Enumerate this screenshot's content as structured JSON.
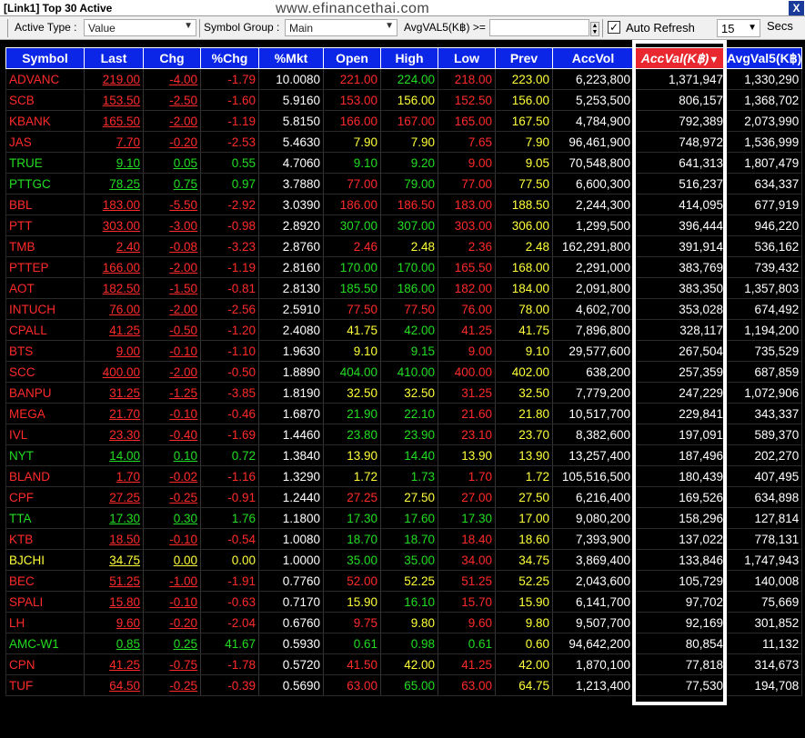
{
  "window": {
    "title": "[Link1] Top 30 Active",
    "watermark": "www.efinancethai.com",
    "close_label": "X"
  },
  "toolbar": {
    "active_type_label": "Active Type :",
    "active_type_value": "Value",
    "symbol_group_label": "Symbol Group :",
    "symbol_group_value": "Main",
    "avgval_label": "AvgVAL5(K฿) >=",
    "auto_refresh_label": "Auto Refresh",
    "auto_refresh_checked": "✓",
    "refresh_interval": "15",
    "secs_label": "Secs"
  },
  "table": {
    "headers": [
      "Symbol",
      "Last",
      "Chg",
      "%Chg",
      "%Mkt",
      "Open",
      "High",
      "Low",
      "Prev",
      "AccVol",
      "AccVal(K฿)",
      "AvgVal5(K฿)"
    ],
    "rows": [
      {
        "c": "red",
        "symbol": "ADVANC",
        "last": "219.00",
        "chg": "-4.00",
        "pchg": "-1.79",
        "mkt": "10.0080",
        "open": "221.00",
        "open_c": "red",
        "high": "224.00",
        "high_c": "green",
        "low": "218.00",
        "low_c": "red",
        "prev": "223.00",
        "accvol": "6,223,800",
        "accval": "1,371,947",
        "avgval": "1,330,290"
      },
      {
        "c": "red",
        "symbol": "SCB",
        "last": "153.50",
        "chg": "-2.50",
        "pchg": "-1.60",
        "mkt": "5.9160",
        "open": "153.00",
        "open_c": "red",
        "high": "156.00",
        "high_c": "yellow",
        "low": "152.50",
        "low_c": "red",
        "prev": "156.00",
        "accvol": "5,253,500",
        "accval": "806,157",
        "avgval": "1,368,702"
      },
      {
        "c": "red",
        "symbol": "KBANK",
        "last": "165.50",
        "chg": "-2.00",
        "pchg": "-1.19",
        "mkt": "5.8150",
        "open": "166.00",
        "open_c": "red",
        "high": "167.00",
        "high_c": "red",
        "low": "165.00",
        "low_c": "red",
        "prev": "167.50",
        "accvol": "4,784,900",
        "accval": "792,389",
        "avgval": "2,073,990"
      },
      {
        "c": "red",
        "symbol": "JAS",
        "last": "7.70",
        "chg": "-0.20",
        "pchg": "-2.53",
        "mkt": "5.4630",
        "open": "7.90",
        "open_c": "yellow",
        "high": "7.90",
        "high_c": "yellow",
        "low": "7.65",
        "low_c": "red",
        "prev": "7.90",
        "accvol": "96,461,900",
        "accval": "748,972",
        "avgval": "1,536,999"
      },
      {
        "c": "green",
        "symbol": "TRUE",
        "last": "9.10",
        "chg": "0.05",
        "pchg": "0.55",
        "mkt": "4.7060",
        "open": "9.10",
        "open_c": "green",
        "high": "9.20",
        "high_c": "green",
        "low": "9.00",
        "low_c": "red",
        "prev": "9.05",
        "accvol": "70,548,800",
        "accval": "641,313",
        "avgval": "1,807,479"
      },
      {
        "c": "green",
        "symbol": "PTTGC",
        "last": "78.25",
        "chg": "0.75",
        "pchg": "0.97",
        "mkt": "3.7880",
        "open": "77.00",
        "open_c": "red",
        "high": "79.00",
        "high_c": "green",
        "low": "77.00",
        "low_c": "red",
        "prev": "77.50",
        "accvol": "6,600,300",
        "accval": "516,237",
        "avgval": "634,337"
      },
      {
        "c": "red",
        "symbol": "BBL",
        "last": "183.00",
        "chg": "-5.50",
        "pchg": "-2.92",
        "mkt": "3.0390",
        "open": "186.00",
        "open_c": "red",
        "high": "186.50",
        "high_c": "red",
        "low": "183.00",
        "low_c": "red",
        "prev": "188.50",
        "accvol": "2,244,300",
        "accval": "414,095",
        "avgval": "677,919"
      },
      {
        "c": "red",
        "symbol": "PTT",
        "last": "303.00",
        "chg": "-3.00",
        "pchg": "-0.98",
        "mkt": "2.8920",
        "open": "307.00",
        "open_c": "green",
        "high": "307.00",
        "high_c": "green",
        "low": "303.00",
        "low_c": "red",
        "prev": "306.00",
        "accvol": "1,299,500",
        "accval": "396,444",
        "avgval": "946,220"
      },
      {
        "c": "red",
        "symbol": "TMB",
        "last": "2.40",
        "chg": "-0.08",
        "pchg": "-3.23",
        "mkt": "2.8760",
        "open": "2.46",
        "open_c": "red",
        "high": "2.48",
        "high_c": "yellow",
        "low": "2.36",
        "low_c": "red",
        "prev": "2.48",
        "accvol": "162,291,800",
        "accval": "391,914",
        "avgval": "536,162"
      },
      {
        "c": "red",
        "symbol": "PTTEP",
        "last": "166.00",
        "chg": "-2.00",
        "pchg": "-1.19",
        "mkt": "2.8160",
        "open": "170.00",
        "open_c": "green",
        "high": "170.00",
        "high_c": "green",
        "low": "165.50",
        "low_c": "red",
        "prev": "168.00",
        "accvol": "2,291,000",
        "accval": "383,769",
        "avgval": "739,432"
      },
      {
        "c": "red",
        "symbol": "AOT",
        "last": "182.50",
        "chg": "-1.50",
        "pchg": "-0.81",
        "mkt": "2.8130",
        "open": "185.50",
        "open_c": "green",
        "high": "186.00",
        "high_c": "green",
        "low": "182.00",
        "low_c": "red",
        "prev": "184.00",
        "accvol": "2,091,800",
        "accval": "383,350",
        "avgval": "1,357,803"
      },
      {
        "c": "red",
        "symbol": "INTUCH",
        "last": "76.00",
        "chg": "-2.00",
        "pchg": "-2.56",
        "mkt": "2.5910",
        "open": "77.50",
        "open_c": "red",
        "high": "77.50",
        "high_c": "red",
        "low": "76.00",
        "low_c": "red",
        "prev": "78.00",
        "accvol": "4,602,700",
        "accval": "353,028",
        "avgval": "674,492"
      },
      {
        "c": "red",
        "symbol": "CPALL",
        "last": "41.25",
        "chg": "-0.50",
        "pchg": "-1.20",
        "mkt": "2.4080",
        "open": "41.75",
        "open_c": "yellow",
        "high": "42.00",
        "high_c": "green",
        "low": "41.25",
        "low_c": "red",
        "prev": "41.75",
        "accvol": "7,896,800",
        "accval": "328,117",
        "avgval": "1,194,200"
      },
      {
        "c": "red",
        "symbol": "BTS",
        "last": "9.00",
        "chg": "-0.10",
        "pchg": "-1.10",
        "mkt": "1.9630",
        "open": "9.10",
        "open_c": "yellow",
        "high": "9.15",
        "high_c": "green",
        "low": "9.00",
        "low_c": "red",
        "prev": "9.10",
        "accvol": "29,577,600",
        "accval": "267,504",
        "avgval": "735,529"
      },
      {
        "c": "red",
        "symbol": "SCC",
        "last": "400.00",
        "chg": "-2.00",
        "pchg": "-0.50",
        "mkt": "1.8890",
        "open": "404.00",
        "open_c": "green",
        "high": "410.00",
        "high_c": "green",
        "low": "400.00",
        "low_c": "red",
        "prev": "402.00",
        "accvol": "638,200",
        "accval": "257,359",
        "avgval": "687,859"
      },
      {
        "c": "red",
        "symbol": "BANPU",
        "last": "31.25",
        "chg": "-1.25",
        "pchg": "-3.85",
        "mkt": "1.8190",
        "open": "32.50",
        "open_c": "yellow",
        "high": "32.50",
        "high_c": "yellow",
        "low": "31.25",
        "low_c": "red",
        "prev": "32.50",
        "accvol": "7,779,200",
        "accval": "247,229",
        "avgval": "1,072,906"
      },
      {
        "c": "red",
        "symbol": "MEGA",
        "last": "21.70",
        "chg": "-0.10",
        "pchg": "-0.46",
        "mkt": "1.6870",
        "open": "21.90",
        "open_c": "green",
        "high": "22.10",
        "high_c": "green",
        "low": "21.60",
        "low_c": "red",
        "prev": "21.80",
        "accvol": "10,517,700",
        "accval": "229,841",
        "avgval": "343,337"
      },
      {
        "c": "red",
        "symbol": "IVL",
        "last": "23.30",
        "chg": "-0.40",
        "pchg": "-1.69",
        "mkt": "1.4460",
        "open": "23.80",
        "open_c": "green",
        "high": "23.90",
        "high_c": "green",
        "low": "23.10",
        "low_c": "red",
        "prev": "23.70",
        "accvol": "8,382,600",
        "accval": "197,091",
        "avgval": "589,370"
      },
      {
        "c": "green",
        "symbol": "NYT",
        "last": "14.00",
        "chg": "0.10",
        "pchg": "0.72",
        "mkt": "1.3840",
        "open": "13.90",
        "open_c": "yellow",
        "high": "14.40",
        "high_c": "green",
        "low": "13.90",
        "low_c": "yellow",
        "prev": "13.90",
        "accvol": "13,257,400",
        "accval": "187,496",
        "avgval": "202,270"
      },
      {
        "c": "red",
        "symbol": "BLAND",
        "last": "1.70",
        "chg": "-0.02",
        "pchg": "-1.16",
        "mkt": "1.3290",
        "open": "1.72",
        "open_c": "yellow",
        "high": "1.73",
        "high_c": "green",
        "low": "1.70",
        "low_c": "red",
        "prev": "1.72",
        "accvol": "105,516,500",
        "accval": "180,439",
        "avgval": "407,495"
      },
      {
        "c": "red",
        "symbol": "CPF",
        "last": "27.25",
        "chg": "-0.25",
        "pchg": "-0.91",
        "mkt": "1.2440",
        "open": "27.25",
        "open_c": "red",
        "high": "27.50",
        "high_c": "yellow",
        "low": "27.00",
        "low_c": "red",
        "prev": "27.50",
        "accvol": "6,216,400",
        "accval": "169,526",
        "avgval": "634,898"
      },
      {
        "c": "green",
        "symbol": "TTA",
        "last": "17.30",
        "chg": "0.30",
        "pchg": "1.76",
        "mkt": "1.1800",
        "open": "17.30",
        "open_c": "green",
        "high": "17.60",
        "high_c": "green",
        "low": "17.30",
        "low_c": "green",
        "prev": "17.00",
        "accvol": "9,080,200",
        "accval": "158,296",
        "avgval": "127,814"
      },
      {
        "c": "red",
        "symbol": "KTB",
        "last": "18.50",
        "chg": "-0.10",
        "pchg": "-0.54",
        "mkt": "1.0080",
        "open": "18.70",
        "open_c": "green",
        "high": "18.70",
        "high_c": "green",
        "low": "18.40",
        "low_c": "red",
        "prev": "18.60",
        "accvol": "7,393,900",
        "accval": "137,022",
        "avgval": "778,131"
      },
      {
        "c": "yellow",
        "symbol": "BJCHI",
        "last": "34.75",
        "chg": "0.00",
        "pchg": "0.00",
        "mkt": "1.0000",
        "open": "35.00",
        "open_c": "green",
        "high": "35.00",
        "high_c": "green",
        "low": "34.00",
        "low_c": "red",
        "prev": "34.75",
        "accvol": "3,869,400",
        "accval": "133,846",
        "avgval": "1,747,943"
      },
      {
        "c": "red",
        "symbol": "BEC",
        "last": "51.25",
        "chg": "-1.00",
        "pchg": "-1.91",
        "mkt": "0.7760",
        "open": "52.00",
        "open_c": "red",
        "high": "52.25",
        "high_c": "yellow",
        "low": "51.25",
        "low_c": "red",
        "prev": "52.25",
        "accvol": "2,043,600",
        "accval": "105,729",
        "avgval": "140,008"
      },
      {
        "c": "red",
        "symbol": "SPALI",
        "last": "15.80",
        "chg": "-0.10",
        "pchg": "-0.63",
        "mkt": "0.7170",
        "open": "15.90",
        "open_c": "yellow",
        "high": "16.10",
        "high_c": "green",
        "low": "15.70",
        "low_c": "red",
        "prev": "15.90",
        "accvol": "6,141,700",
        "accval": "97,702",
        "avgval": "75,669"
      },
      {
        "c": "red",
        "symbol": "LH",
        "last": "9.60",
        "chg": "-0.20",
        "pchg": "-2.04",
        "mkt": "0.6760",
        "open": "9.75",
        "open_c": "red",
        "high": "9.80",
        "high_c": "yellow",
        "low": "9.60",
        "low_c": "red",
        "prev": "9.80",
        "accvol": "9,507,700",
        "accval": "92,169",
        "avgval": "301,852"
      },
      {
        "c": "green",
        "symbol": "AMC-W1",
        "last": "0.85",
        "chg": "0.25",
        "pchg": "41.67",
        "mkt": "0.5930",
        "open": "0.61",
        "open_c": "green",
        "high": "0.98",
        "high_c": "green",
        "low": "0.61",
        "low_c": "green",
        "prev": "0.60",
        "accvol": "94,642,200",
        "accval": "80,854",
        "avgval": "11,132"
      },
      {
        "c": "red",
        "symbol": "CPN",
        "last": "41.25",
        "chg": "-0.75",
        "pchg": "-1.78",
        "mkt": "0.5720",
        "open": "41.50",
        "open_c": "red",
        "high": "42.00",
        "high_c": "yellow",
        "low": "41.25",
        "low_c": "red",
        "prev": "42.00",
        "accvol": "1,870,100",
        "accval": "77,818",
        "avgval": "314,673"
      },
      {
        "c": "red",
        "symbol": "TUF",
        "last": "64.50",
        "chg": "-0.25",
        "pchg": "-0.39",
        "mkt": "0.5690",
        "open": "63.00",
        "open_c": "red",
        "high": "65.00",
        "high_c": "green",
        "low": "63.00",
        "low_c": "red",
        "prev": "64.75",
        "accvol": "1,213,400",
        "accval": "77,530",
        "avgval": "194,708"
      }
    ]
  },
  "colors": {
    "header_blue": "#0b26e6",
    "sorted_red": "#e8272f",
    "up_green": "#22dd22",
    "down_red": "#ff2a2a",
    "unchanged_yellow": "#ffff3a"
  }
}
